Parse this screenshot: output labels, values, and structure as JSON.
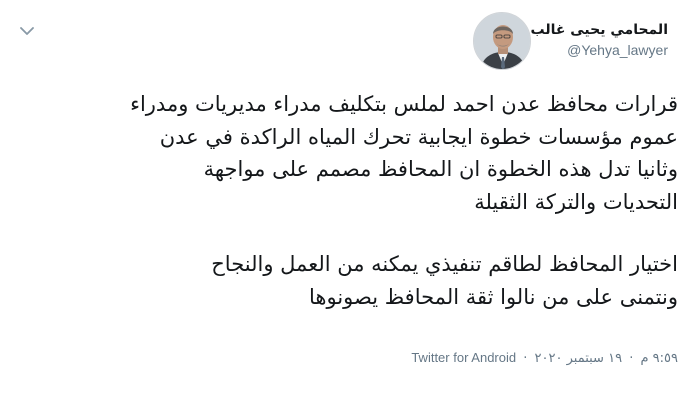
{
  "author": {
    "display_name": "المحامي يحيى غالب",
    "handle": "@Yehya_lawyer"
  },
  "tweet": {
    "paragraph1_lines": [
      "قرارات محافظ عدن احمد لملس بتكليف مدراء مديريات ومدراء",
      "عموم مؤسسات خطوة ايجابية تحرك المياه الراكدة في عدن",
      "وثانيا تدل هذه الخطوة ان المحافظ مصمم على مواجهة",
      "التحديات والتركة الثقيلة"
    ],
    "paragraph2_lines": [
      "اختيار المحافظ لطاقم تنفيذي يمكنه من العمل والنجاح",
      "ونتمنى على من نالوا ثقة المحافظ يصونوها"
    ]
  },
  "meta": {
    "time": "٩:٥٩ م",
    "date": "١٩ سبتمبر ٢٠٢٠",
    "separator": "·",
    "source": "Twitter for Android"
  },
  "icons": {
    "more": "chevron-down-icon",
    "avatar": "profile-photo"
  },
  "colors": {
    "text": "#14171a",
    "secondary": "#657786",
    "background": "#ffffff"
  }
}
